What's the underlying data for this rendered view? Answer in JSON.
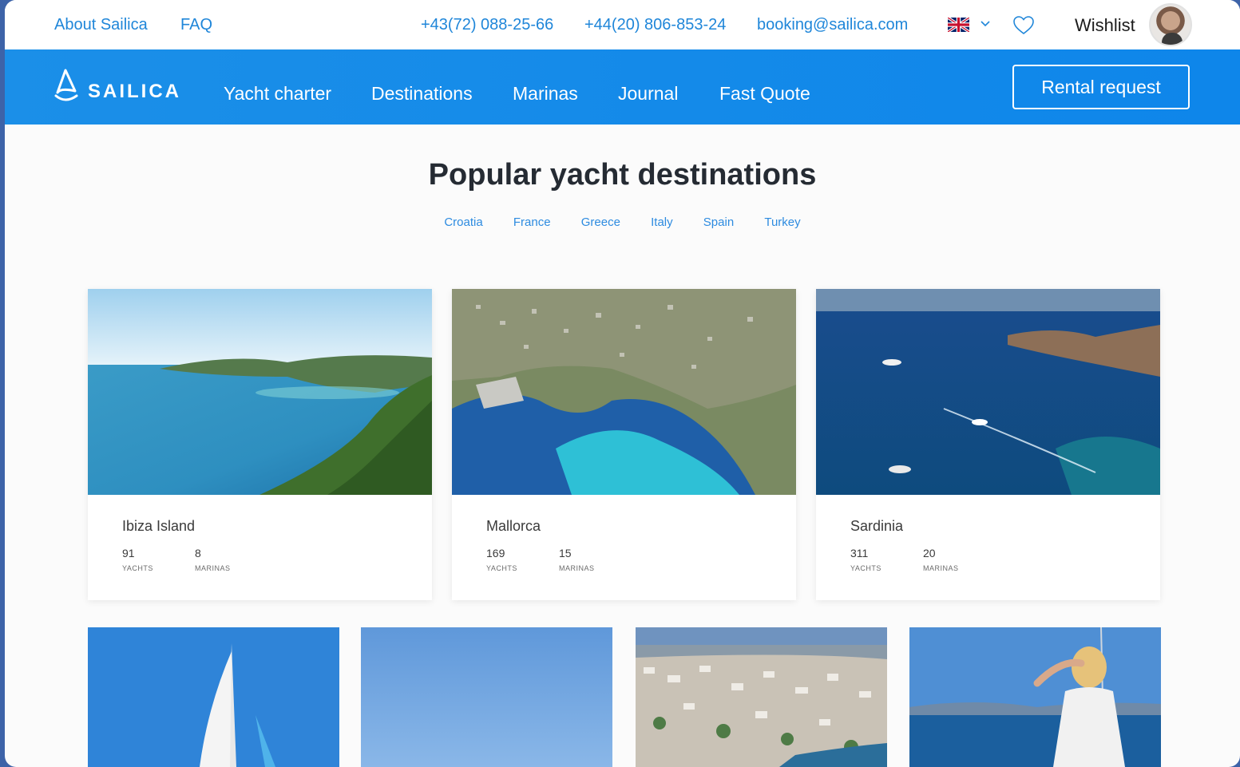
{
  "topbar": {
    "about": "About Sailica",
    "faq": "FAQ",
    "phone1": "+43(72) 088-25-66",
    "phone2": "+44(20) 806-853-24",
    "email": "booking@sailica.com",
    "wishlist": "Wishlist"
  },
  "nav": {
    "logo": "SAILICA",
    "items": [
      "Yacht charter",
      "Destinations",
      "Marinas",
      "Journal",
      "Fast Quote"
    ],
    "cta": "Rental request"
  },
  "section": {
    "title": "Popular yacht destinations",
    "filters": [
      "Croatia",
      "France",
      "Greece",
      "Italy",
      "Spain",
      "Turkey"
    ]
  },
  "cards": [
    {
      "name": "Ibiza Island",
      "yachts": "91",
      "marinas": "8",
      "yachts_label": "YACHTS",
      "marinas_label": "MARINAS"
    },
    {
      "name": "Mallorca",
      "yachts": "169",
      "marinas": "15",
      "yachts_label": "YACHTS",
      "marinas_label": "MARINAS"
    },
    {
      "name": "Sardinia",
      "yachts": "311",
      "marinas": "20",
      "yachts_label": "YACHTS",
      "marinas_label": "MARINAS"
    }
  ],
  "colors": {
    "brand_blue": "#1b8fe8",
    "link_blue": "#1f86d9",
    "frame": "#3d63a8"
  },
  "icons": [
    "uk-flag-icon",
    "chevron-down-icon",
    "heart-icon",
    "sailboat-logo-icon"
  ]
}
